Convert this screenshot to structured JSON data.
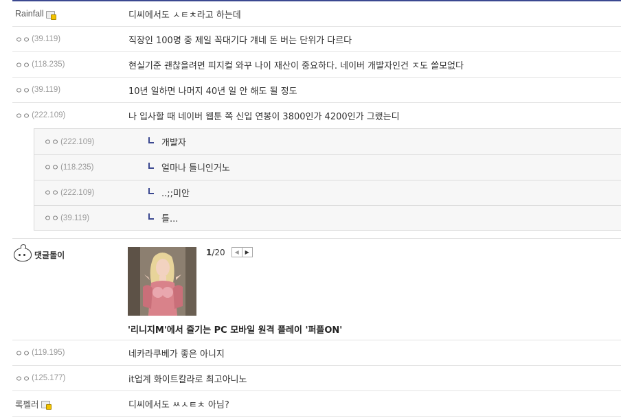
{
  "comments": [
    {
      "nick": "Rainfall",
      "ip": "",
      "member": true,
      "text": "디씨에서도 ㅅㅌㅊ라고 하는데"
    },
    {
      "nick": "ㅇㅇ",
      "ip": "(39.119)",
      "member": false,
      "text": "직장인 100명 중 제일 꼭대기다 걔네 돈 버는 단위가 다르다"
    },
    {
      "nick": "ㅇㅇ",
      "ip": "(118.235)",
      "member": false,
      "text": "현실기준 괜찮을려면 피지컬 와꾸 나이 재산이 중요하다. 네이버 개발자인건 ㅈ도 쓸모없다"
    },
    {
      "nick": "ㅇㅇ",
      "ip": "(39.119)",
      "member": false,
      "text": "10년 일하면 나머지 40년 일 안 해도 될 정도"
    },
    {
      "nick": "ㅇㅇ",
      "ip": "(222.109)",
      "member": false,
      "text": "나 입사할 때 네이버 웹툰 쪽 신입 연봉이 3800인가 4200인가 그랬는디"
    }
  ],
  "replies": [
    {
      "nick": "ㅇㅇ",
      "ip": "(222.109)",
      "text": "개발자"
    },
    {
      "nick": "ㅇㅇ",
      "ip": "(118.235)",
      "text": "얼마나 틀니인거노"
    },
    {
      "nick": "ㅇㅇ",
      "ip": "(222.109)",
      "text": "..;;미안"
    },
    {
      "nick": "ㅇㅇ",
      "ip": "(39.119)",
      "text": "틀..."
    }
  ],
  "ad": {
    "nick": "댓글돌이",
    "page_current": "1",
    "page_total": "/20",
    "title": "'리니지M'에서 즐기는 PC 모바일 원격 플레이 '퍼플ON'"
  },
  "comments2": [
    {
      "nick": "ㅇㅇ",
      "ip": "(119.195)",
      "member": false,
      "text": "네카라쿠베가 좋은 아니지"
    },
    {
      "nick": "ㅇㅇ",
      "ip": "(125.177)",
      "member": false,
      "text": "it업계 화이트칼라로 최고아니노"
    },
    {
      "nick": "록펠러",
      "ip": "",
      "member": true,
      "text": "디씨에서도 ㅆㅅㅌㅊ 아님?"
    }
  ],
  "colors": {
    "accent": "#3b4890",
    "text": "#333333",
    "ip": "#999999"
  }
}
